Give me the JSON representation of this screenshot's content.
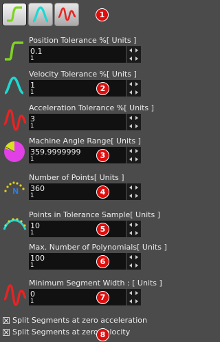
{
  "toolbar": {
    "buttons": [
      {
        "name": "position-mode",
        "icon": "position-curve-icon",
        "color": "#7fd321"
      },
      {
        "name": "velocity-mode",
        "icon": "velocity-curve-icon",
        "color": "#1ad9d4"
      },
      {
        "name": "acceleration-mode",
        "icon": "acceleration-curve-icon",
        "color": "#e82323"
      }
    ],
    "badge": "1"
  },
  "fields": [
    {
      "label": "Position Tolerance %[ Units ]",
      "value": "0.1",
      "step": "1",
      "icon": "position-curve-icon",
      "badge": ""
    },
    {
      "label": "Velocity Tolerance %[ Units ]",
      "value": "1",
      "step": "1",
      "icon": "velocity-curve-icon",
      "badge": "2"
    },
    {
      "label": "Acceleration Tolerance %[ Units ]",
      "value": "3",
      "step": "1",
      "icon": "acceleration-curve-icon",
      "badge": ""
    },
    {
      "label": "Machine Angle Range[ Units ]",
      "value": "359.9999999",
      "step": "1",
      "icon": "pie-chart-icon",
      "badge": "3"
    },
    {
      "label": "Number of Points[ Units ]",
      "value": "360",
      "step": "1",
      "icon": "points-curve-icon",
      "badge": "4"
    },
    {
      "label": "Points in Tolerance Sample[ Units ]",
      "value": "10",
      "step": "1",
      "icon": "tolerance-sample-icon",
      "badge": "5"
    },
    {
      "label": "Max. Number of Polynomials[ Units ]",
      "value": "100",
      "step": "1",
      "icon": "",
      "badge": "6"
    },
    {
      "label": "Minimum Segment Width : [ Units ]",
      "value": "0",
      "step": "1",
      "icon": "acceleration-curve-icon",
      "badge": "7"
    }
  ],
  "checkboxes": [
    {
      "label": "Split Segments at zero acceleration",
      "checked": true
    },
    {
      "label": "Split Segments at zero velocity",
      "checked": true
    }
  ],
  "checkbox_badge": "8",
  "colors": {
    "green": "#7fd321",
    "cyan": "#1ad9d4",
    "red": "#e82323",
    "pie_pink": "#e040e6",
    "pie_yellow": "#d8e020",
    "dots_yellow": "#e5d21a",
    "badge": "#e00d0d"
  }
}
